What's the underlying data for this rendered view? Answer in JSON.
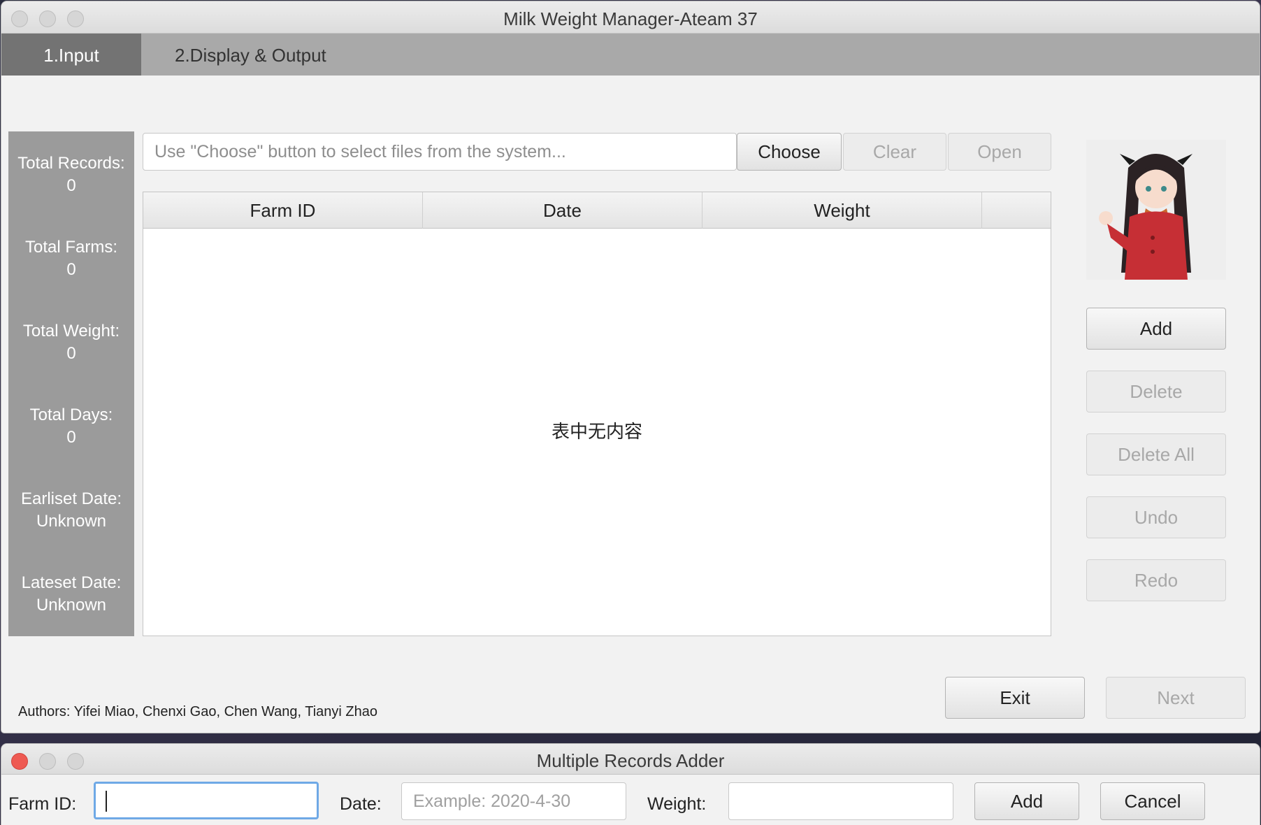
{
  "main_window": {
    "title": "Milk Weight Manager-Ateam 37",
    "tabs": [
      {
        "label": "1.Input"
      },
      {
        "label": "2.Display & Output"
      }
    ],
    "stats": [
      {
        "label": "Total Records:",
        "value": "0"
      },
      {
        "label": "Total Farms:",
        "value": "0"
      },
      {
        "label": "Total Weight:",
        "value": "0"
      },
      {
        "label": "Total Days:",
        "value": "0"
      },
      {
        "label": "Earliset Date:",
        "value": "Unknown"
      },
      {
        "label": "Lateset Date:",
        "value": "Unknown"
      }
    ],
    "file_path": {
      "placeholder": "Use \"Choose\" button to select files from the system..."
    },
    "file_buttons": {
      "choose": "Choose",
      "clear": "Clear",
      "open": "Open"
    },
    "table": {
      "columns": [
        "Farm ID",
        "Date",
        "Weight"
      ],
      "empty_text": "表中无内容"
    },
    "side_buttons": {
      "add": "Add",
      "delete": "Delete",
      "delete_all": "Delete All",
      "undo": "Undo",
      "redo": "Redo"
    },
    "footer": {
      "authors": "Authors: Yifei Miao, Chenxi Gao, Chen Wang, Tianyi Zhao",
      "exit": "Exit",
      "next": "Next"
    }
  },
  "adder_window": {
    "title": "Multiple Records Adder",
    "farm_id_label": "Farm ID:",
    "farm_id_value": "",
    "date_label": "Date:",
    "date_placeholder": "Example: 2020-4-30",
    "weight_label": "Weight:",
    "weight_value": "",
    "add": "Add",
    "cancel": "Cancel"
  },
  "colors": {
    "tab_active": "#737373",
    "tab_bar": "#a9a9a9",
    "stats_panel": "#9b9b9b",
    "close_red": "#ee5a52",
    "focus_blue": "#6fa9e6"
  }
}
